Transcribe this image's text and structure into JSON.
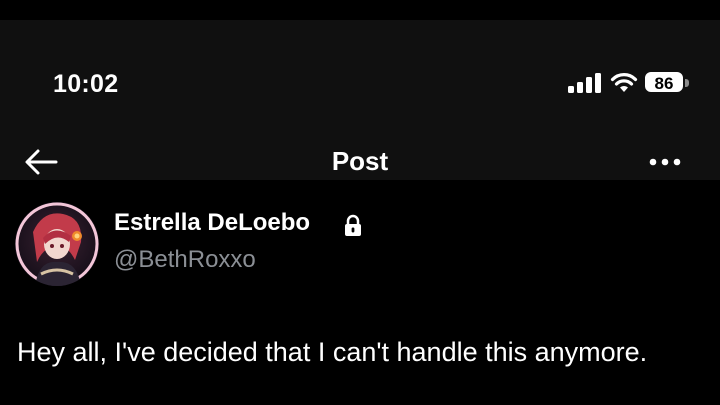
{
  "status_bar": {
    "time": "10:02",
    "battery_level": "86",
    "icons": [
      "signal-icon",
      "wifi-icon",
      "battery-icon"
    ]
  },
  "header": {
    "title": "Post",
    "back_icon": "arrow-left-icon",
    "more_icon": "more-horizontal-icon"
  },
  "post": {
    "author": {
      "display_name": "Estrella DeLoebo",
      "handle": "@BethRoxxo",
      "protected_icon": "lock-icon"
    },
    "text": "Hey all, I've decided that I can't handle this anymore."
  },
  "colors": {
    "background": "#000000",
    "header_background": "#101010",
    "secondary_text": "#8b8f95",
    "primary_text": "#ffffff"
  }
}
